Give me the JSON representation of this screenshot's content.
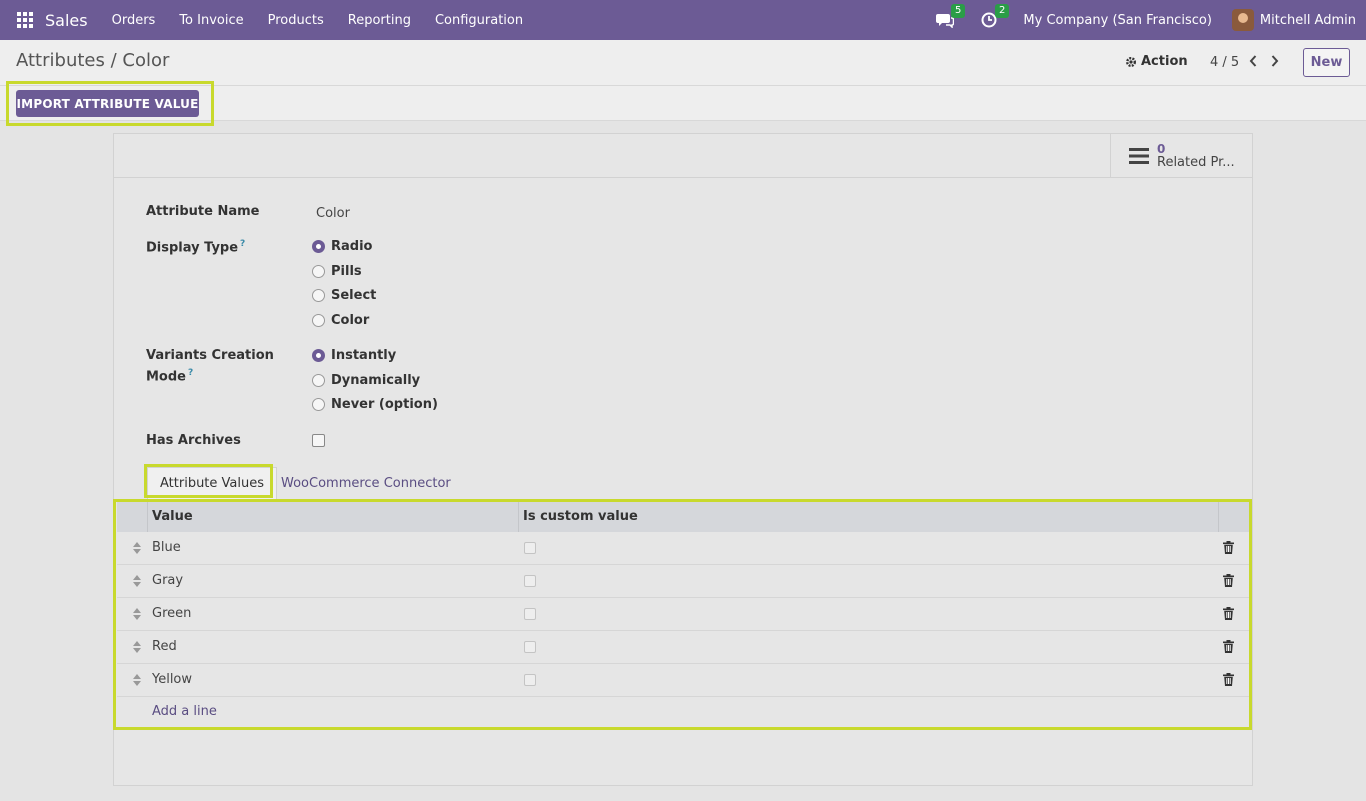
{
  "navbar": {
    "app_name": "Sales",
    "menu": [
      "Orders",
      "To Invoice",
      "Products",
      "Reporting",
      "Configuration"
    ],
    "messages_badge": "5",
    "activities_badge": "2",
    "company": "My Company (San Francisco)",
    "user": "Mitchell Admin"
  },
  "control": {
    "breadcrumb_parent": "Attributes",
    "breadcrumb_sep": " / ",
    "breadcrumb_current": "Color",
    "action_label": "Action",
    "pager": "4 / 5",
    "new_label": "New"
  },
  "statusbar": {
    "import_label": "IMPORT ATTRIBUTE VALUE"
  },
  "smart_button": {
    "count": "0",
    "label": "Related Pr..."
  },
  "form": {
    "attribute_name_label": "Attribute Name",
    "attribute_name_value": "Color",
    "display_type_label": "Display Type",
    "help_mark": "?",
    "display_type_options": [
      "Radio",
      "Pills",
      "Select",
      "Color"
    ],
    "display_type_selected": "Radio",
    "variants_label_line1": "Variants Creation",
    "variants_label_line2": "Mode",
    "variants_options": [
      "Instantly",
      "Dynamically",
      "Never (option)"
    ],
    "variants_selected": "Instantly",
    "has_archives_label": "Has Archives",
    "has_archives_checked": false
  },
  "tabs": [
    {
      "label": "Attribute Values",
      "active": true
    },
    {
      "label": "WooCommerce Connector",
      "active": false
    }
  ],
  "table": {
    "col_value": "Value",
    "col_custom": "Is custom value",
    "rows": [
      {
        "value": "Blue",
        "is_custom": false
      },
      {
        "value": "Gray",
        "is_custom": false
      },
      {
        "value": "Green",
        "is_custom": false
      },
      {
        "value": "Red",
        "is_custom": false
      },
      {
        "value": "Yellow",
        "is_custom": false
      }
    ],
    "add_line": "Add a line"
  },
  "colors": {
    "brand": "#6c5b95",
    "highlight": "#c8d92d",
    "badge": "#2a9d47"
  }
}
